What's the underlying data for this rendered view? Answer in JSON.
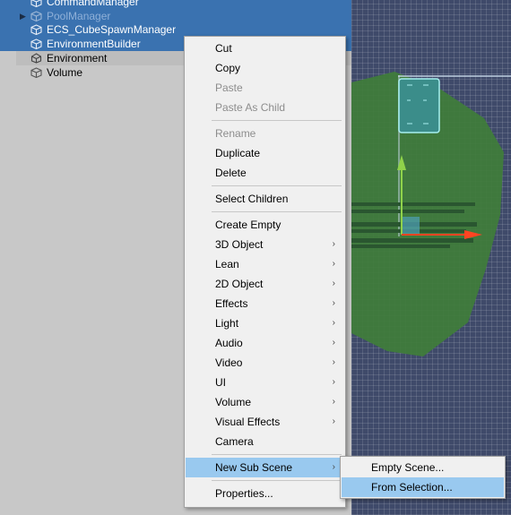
{
  "hierarchy": {
    "items": [
      {
        "label": "CommandManager"
      },
      {
        "label": "PoolManager"
      },
      {
        "label": "ECS_CubeSpawnManager"
      },
      {
        "label": "EnvironmentBuilder"
      },
      {
        "label": "Environment"
      },
      {
        "label": "Volume"
      }
    ]
  },
  "context_menu": {
    "cut": "Cut",
    "copy": "Copy",
    "paste": "Paste",
    "paste_as_child": "Paste As Child",
    "rename": "Rename",
    "duplicate": "Duplicate",
    "delete": "Delete",
    "select_children": "Select Children",
    "create_empty": "Create Empty",
    "object_3d": "3D Object",
    "lean": "Lean",
    "object_2d": "2D Object",
    "effects": "Effects",
    "light": "Light",
    "audio": "Audio",
    "video": "Video",
    "ui": "UI",
    "volume": "Volume",
    "visual_effects": "Visual Effects",
    "camera": "Camera",
    "new_sub_scene": "New Sub Scene",
    "properties": "Properties...",
    "submenu_arrow": "›"
  },
  "submenu": {
    "empty_scene": "Empty Scene...",
    "from_selection": "From Selection..."
  },
  "colors": {
    "selection": "#3a72b0",
    "menu_bg": "#f0f0f0",
    "menu_highlight": "#99c9ef",
    "scene_green": "#3f7d3a"
  }
}
